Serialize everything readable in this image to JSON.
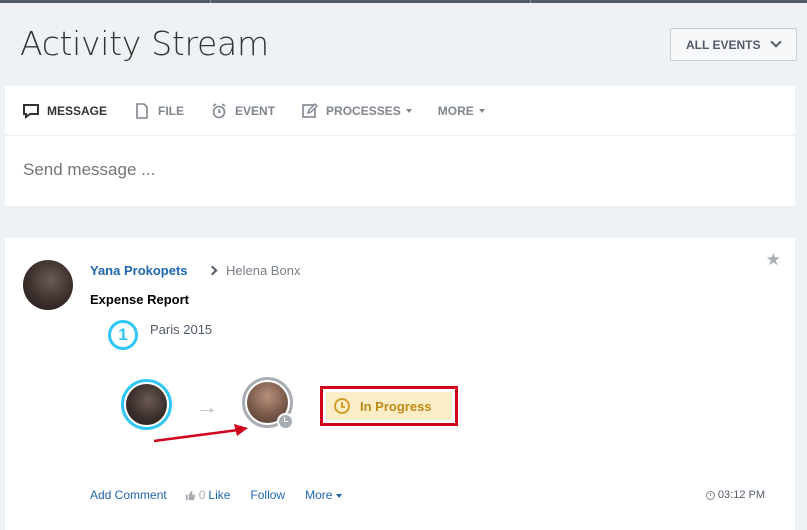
{
  "page": {
    "title": "Activity Stream",
    "filter_label": "ALL EVENTS"
  },
  "composer": {
    "tabs": [
      {
        "label": "MESSAGE",
        "icon": "message-icon",
        "active": true
      },
      {
        "label": "FILE",
        "icon": "file-icon"
      },
      {
        "label": "EVENT",
        "icon": "alarm-clock-icon"
      },
      {
        "label": "PROCESSES",
        "icon": "edit-icon",
        "has_dropdown": true
      },
      {
        "label": "MORE",
        "has_dropdown": true
      }
    ],
    "placeholder": "Send message ..."
  },
  "post": {
    "author": "Yana Prokopets",
    "recipient": "Helena Bonx",
    "title": "Expense Report",
    "step_number": "1",
    "step_label": "Paris 2015",
    "status": "In Progress",
    "status_color": "#c08a17",
    "actions": {
      "comment": "Add Comment",
      "like_count": "0",
      "like": "Like",
      "follow": "Follow",
      "more": "More"
    },
    "time": "03:12 PM"
  },
  "colors": {
    "accent": "#2fc6f6",
    "link": "#2067b0",
    "annotation": "#d0021b"
  }
}
